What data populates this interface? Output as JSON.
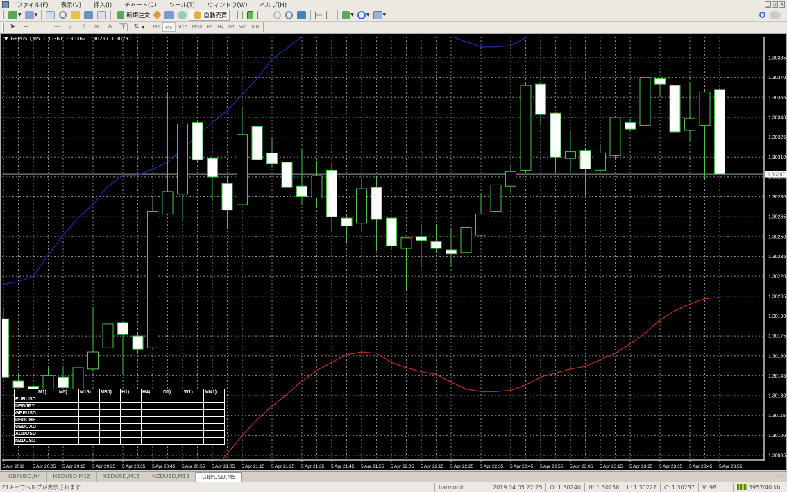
{
  "menu": [
    "ファイル(F)",
    "表示(V)",
    "挿入(I)",
    "チャート(C)",
    "ツール(T)",
    "ウィンドウ(W)",
    "ヘルプ(H)"
  ],
  "toolbar": {
    "new_order": "新規注文",
    "auto_trading": "自動売買"
  },
  "timeframes": [
    "M1",
    "M5",
    "M15",
    "M30",
    "H1",
    "H4",
    "D1",
    "W1",
    "MN"
  ],
  "active_timeframe": "M5",
  "chart_header": {
    "symbol": "GBPUSD,M5",
    "open": "1.30361",
    "high": "1.30362",
    "low": "1.30297",
    "close": "1.30297"
  },
  "symbol_table": {
    "columns": [
      "M1)",
      "M5)",
      "M15)",
      "M30)",
      "H1)",
      "H4)",
      "D1)",
      "W1)",
      "MN1)"
    ],
    "rows": [
      "EURUSD",
      "USDJPY",
      "GBPUSD",
      "USDCHF",
      "USDCAD",
      "AUDUSD",
      "NZDUSD"
    ]
  },
  "tabs": [
    "GBPUSD,H4",
    "NZDUSD,M15",
    "NZDUSD,M15",
    "NZDUSD,M15",
    "GBPUSD,M5"
  ],
  "active_tab": 4,
  "status": {
    "help": "F1キーでヘルプが表示されます",
    "profile": "harmonic",
    "datetime": "2019.04.05 22:25",
    "open": "O: 1.30240",
    "high": "H: 1.30256",
    "low": "L: 1.30227",
    "close": "C: 1.30237",
    "volume": "V: 98",
    "traffic": "5957/40 kb"
  },
  "colors": {
    "bull_body": "#000000",
    "bear_body": "#ffffff",
    "candle_outline": "#4fc24f",
    "upper_line": "#1f2fb0",
    "lower_line": "#c0301e",
    "grid": "#8c8c8c",
    "background": "#000000"
  },
  "chart_data": {
    "type": "candlestick",
    "symbol": "GBPUSD",
    "timeframe": "M5",
    "ylim": [
      1.3008,
      1.304
    ],
    "grid": true,
    "current_price": "1.30297",
    "y_ticks": [
      "1.30385",
      "1.30370",
      "1.30355",
      "1.30340",
      "1.30325",
      "1.30310",
      "1.30295",
      "1.30280",
      "1.30265",
      "1.30250",
      "1.30235",
      "1.30220",
      "1.30205",
      "1.30190",
      "1.30175",
      "1.30160",
      "1.30145",
      "1.30130",
      "1.30115",
      "1.30100",
      "1.30085"
    ],
    "x_tick_labels": [
      "5 Apr 2019",
      "5 Apr 20:05",
      "5 Apr 20:15",
      "5 Apr 20:25",
      "5 Apr 20:35",
      "5 Apr 20:45",
      "5 Apr 20:55",
      "5 Apr 21:05",
      "5 Apr 21:15",
      "5 Apr 21:25",
      "5 Apr 21:35",
      "5 Apr 21:45",
      "5 Apr 21:55",
      "5 Apr 22:05",
      "5 Apr 22:15",
      "5 Apr 22:25",
      "5 Apr 22:35",
      "5 Apr 22:45",
      "5 Apr 22:55",
      "5 Apr 23:05",
      "5 Apr 23:15",
      "5 Apr 23:25",
      "5 Apr 23:35",
      "5 Apr 23:45",
      "5 Apr 23:55"
    ],
    "times": [
      "19:55",
      "20:00",
      "20:05",
      "20:10",
      "20:15",
      "20:20",
      "20:25",
      "20:30",
      "20:35",
      "20:40",
      "20:45",
      "20:50",
      "20:55",
      "21:00",
      "21:05",
      "21:10",
      "21:15",
      "21:20",
      "21:25",
      "21:30",
      "21:35",
      "21:40",
      "21:45",
      "21:50",
      "21:55",
      "22:00",
      "22:05",
      "22:10",
      "22:15",
      "22:20",
      "22:25",
      "22:30",
      "22:35",
      "22:40",
      "22:45",
      "22:50",
      "22:55",
      "23:00",
      "23:05",
      "23:10",
      "23:15",
      "23:20",
      "23:25",
      "23:30",
      "23:35",
      "23:40",
      "23:45",
      "23:50",
      "23:55"
    ],
    "ohlc": [
      [
        1.30188,
        1.30195,
        1.30143,
        1.30144
      ],
      [
        1.30141,
        1.30146,
        1.30135,
        1.30136
      ],
      [
        1.30137,
        1.30138,
        1.30134,
        1.30135
      ],
      [
        1.30135,
        1.30151,
        1.30134,
        1.30145
      ],
      [
        1.30144,
        1.30151,
        1.30135,
        1.30136
      ],
      [
        1.30135,
        1.30159,
        1.30134,
        1.30151
      ],
      [
        1.3015,
        1.30197,
        1.30148,
        1.30163
      ],
      [
        1.30166,
        1.30186,
        1.30162,
        1.30184
      ],
      [
        1.30185,
        1.30186,
        1.30145,
        1.30176
      ],
      [
        1.30175,
        1.30178,
        1.30162,
        1.30165
      ],
      [
        1.30166,
        1.3028,
        1.30164,
        1.30269
      ],
      [
        1.30267,
        1.30358,
        1.30266,
        1.30284
      ],
      [
        1.30282,
        1.30336,
        1.30262,
        1.30335
      ],
      [
        1.30336,
        1.30337,
        1.30306,
        1.30308
      ],
      [
        1.30309,
        1.3031,
        1.30277,
        1.30295
      ],
      [
        1.3029,
        1.30296,
        1.30256,
        1.3027
      ],
      [
        1.30274,
        1.30348,
        1.30273,
        1.30327
      ],
      [
        1.30333,
        1.30348,
        1.30304,
        1.30308
      ],
      [
        1.30313,
        1.30324,
        1.30302,
        1.30305
      ],
      [
        1.30306,
        1.30313,
        1.30283,
        1.30287
      ],
      [
        1.30288,
        1.30316,
        1.30274,
        1.3028
      ],
      [
        1.30279,
        1.30307,
        1.30272,
        1.30296
      ],
      [
        1.303,
        1.30306,
        1.30254,
        1.30265
      ],
      [
        1.30264,
        1.30267,
        1.30245,
        1.30258
      ],
      [
        1.3026,
        1.30294,
        1.30254,
        1.30286
      ],
      [
        1.30287,
        1.30295,
        1.30239,
        1.30263
      ],
      [
        1.30264,
        1.30265,
        1.3024,
        1.30243
      ],
      [
        1.30241,
        1.3025,
        1.30209,
        1.30249
      ],
      [
        1.3025,
        1.30258,
        1.30228,
        1.30247
      ],
      [
        1.30246,
        1.30259,
        1.30238,
        1.30241
      ],
      [
        1.3024,
        1.30256,
        1.30227,
        1.30237
      ],
      [
        1.30238,
        1.30274,
        1.30237,
        1.30257
      ],
      [
        1.30251,
        1.30282,
        1.3025,
        1.30267
      ],
      [
        1.30269,
        1.3029,
        1.30256,
        1.30289
      ],
      [
        1.30288,
        1.30303,
        1.30283,
        1.30299
      ],
      [
        1.303,
        1.30366,
        1.30298,
        1.30364
      ],
      [
        1.30365,
        1.30367,
        1.30334,
        1.30342
      ],
      [
        1.30343,
        1.30344,
        1.30298,
        1.3031
      ],
      [
        1.30309,
        1.30329,
        1.30298,
        1.30314
      ],
      [
        1.30315,
        1.30317,
        1.30281,
        1.30301
      ],
      [
        1.303,
        1.30318,
        1.30299,
        1.30313
      ],
      [
        1.30311,
        1.30341,
        1.30309,
        1.3034
      ],
      [
        1.30336,
        1.30339,
        1.3033,
        1.30331
      ],
      [
        1.30334,
        1.3038,
        1.3033,
        1.3037
      ],
      [
        1.30369,
        1.3037,
        1.30356,
        1.30365
      ],
      [
        1.30364,
        1.30369,
        1.30328,
        1.30329
      ],
      [
        1.3033,
        1.30366,
        1.30322,
        1.30339
      ],
      [
        1.30334,
        1.30361,
        1.30293,
        1.30359
      ],
      [
        1.30361,
        1.30362,
        1.30297,
        1.30297
      ]
    ],
    "lines": [
      {
        "color": "#1f2fb0",
        "values": [
          1.30214,
          1.30216,
          1.3022,
          1.30236,
          1.30251,
          1.30264,
          1.30274,
          1.30288,
          1.30296,
          1.30296,
          1.30301,
          1.30306,
          1.30316,
          1.30326,
          1.30336,
          1.30345,
          1.30357,
          1.30369,
          1.30384,
          1.30392,
          1.30401,
          null,
          null,
          null,
          null,
          null,
          null,
          null,
          null,
          null,
          1.30401,
          1.30397,
          1.30393,
          1.30393,
          1.30394,
          1.304,
          null,
          null,
          null,
          null,
          null,
          null,
          null,
          null,
          null,
          null,
          null,
          null,
          null
        ]
      },
      {
        "color": "#c0301e",
        "values": [
          null,
          null,
          null,
          null,
          null,
          null,
          null,
          null,
          null,
          null,
          null,
          null,
          null,
          null,
          1.30073,
          1.30086,
          1.301,
          1.30112,
          1.30122,
          1.30131,
          1.30141,
          1.30149,
          1.30155,
          1.30161,
          1.30163,
          1.30162,
          1.30155,
          1.30151,
          1.30148,
          1.30146,
          1.3014,
          1.30135,
          1.30133,
          1.30133,
          1.30134,
          1.30138,
          1.30144,
          1.30147,
          1.3015,
          1.30152,
          1.30157,
          1.30162,
          1.30169,
          1.30177,
          1.30187,
          1.30194,
          1.30199,
          1.30203,
          1.30204
        ]
      }
    ]
  }
}
